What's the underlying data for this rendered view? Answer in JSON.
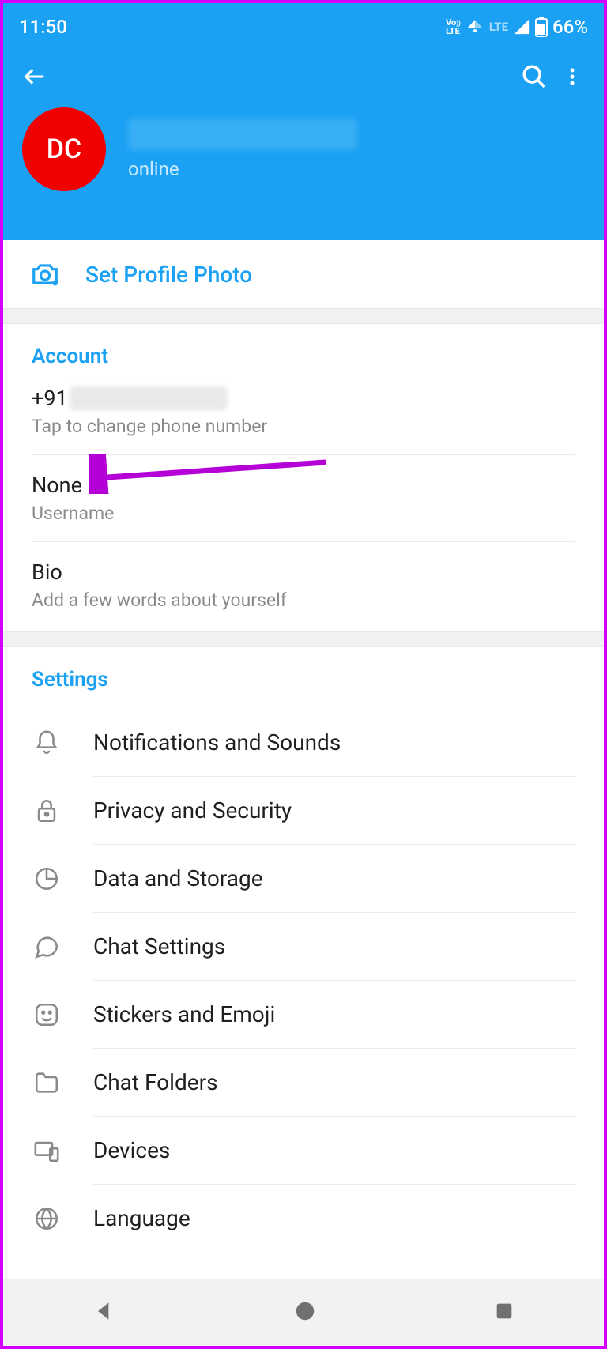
{
  "status": {
    "time": "11:50",
    "volte": "Vo))\nLTE",
    "lte": "LTE",
    "battery": "66%"
  },
  "profile": {
    "avatar_initials": "DC",
    "status": "online",
    "set_photo_label": "Set Profile Photo"
  },
  "account": {
    "title": "Account",
    "phone_prefix": "+91",
    "phone_sub": "Tap to change phone number",
    "username_value": "None",
    "username_sub": "Username",
    "bio_value": "Bio",
    "bio_sub": "Add a few words about yourself"
  },
  "settings": {
    "title": "Settings",
    "items": [
      "Notifications and Sounds",
      "Privacy and Security",
      "Data and Storage",
      "Chat Settings",
      "Stickers and Emoji",
      "Chat Folders",
      "Devices",
      "Language"
    ]
  }
}
